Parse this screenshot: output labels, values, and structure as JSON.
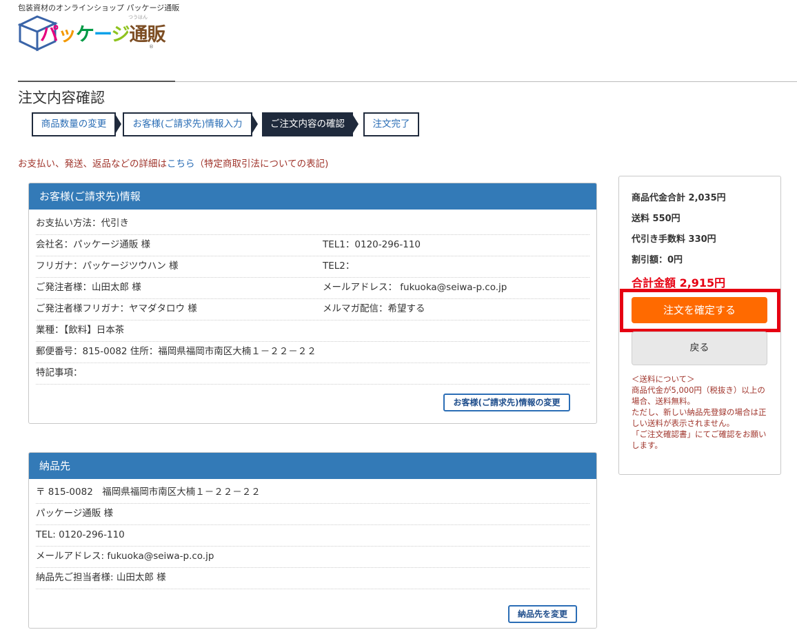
{
  "header": {
    "tagline": "包装資材のオンラインショップ パッケージ通販",
    "logo_text": "パッケージ通販",
    "logo_ruby": "つうはん",
    "logo_reg": "®"
  },
  "page_title": "注文内容確認",
  "steps": [
    {
      "label": "商品数量の変更"
    },
    {
      "label": "お客様(ご請求先)情報入力"
    },
    {
      "label": "ご注文内容の確認"
    },
    {
      "label": "注文完了"
    }
  ],
  "notice": {
    "before": "お支払い、発送、返品などの詳細は",
    "link": "こちら",
    "after": "（特定商取引法についての表記)"
  },
  "customer": {
    "heading": "お客様(ご請求先)情報",
    "payment": "お支払い方法：代引き",
    "company": "会社名：パッケージ通販 様",
    "tel1": "TEL1：0120-296-110",
    "kana": "フリガナ：パッケージツウハン 様",
    "tel2": "TEL2：",
    "orderer": "ご発注者様：山田太郎 様",
    "email": "メールアドレス： fukuoka@seiwa-p.co.jp",
    "orderer_kana": "ご発注者様フリガナ：ヤマダタロウ 様",
    "newsletter": "メルマガ配信：希望する",
    "industry": "業種：【飲料】日本茶",
    "address": "郵便番号：815-0082 住所：福岡県福岡市南区大楠１－２２－２２",
    "remarks": "特記事項：",
    "change_button": "お客様(ご請求先)情報の変更"
  },
  "delivery": {
    "heading": "納品先",
    "postal_address": "〒 815-0082　福岡県福岡市南区大楠１－２２－２２",
    "name": "パッケージ通販 様",
    "tel": "TEL: 0120-296-110",
    "email": "メールアドレス: fukuoka@seiwa-p.co.jp",
    "contact": "納品先ご担当者様: 山田太郎 様",
    "change_button": "納品先を変更"
  },
  "summary": {
    "subtotal": "商品代金合計 2,035円",
    "shipping": "送料 550円",
    "cod_fee": "代引き手数料 330円",
    "discount": "割引額：0円",
    "total": "合計金額 2,915円",
    "confirm_button": "注文を確定する",
    "back_button": "戻る",
    "note": [
      "＜送料について＞",
      "商品代金が5,000円（税抜き）以上の場合、送料無料。",
      "ただし、新しい納品先登録の場合は正しい送料が表示されません。",
      "「ご注文確認書」にてご確認をお願いします。"
    ]
  },
  "colors": {
    "primary_blue": "#337ab7",
    "step_dark": "#1f2a3c",
    "confirm_orange": "#ff6a00",
    "highlight_red": "#e60012",
    "notice_text": "#a0352c"
  }
}
